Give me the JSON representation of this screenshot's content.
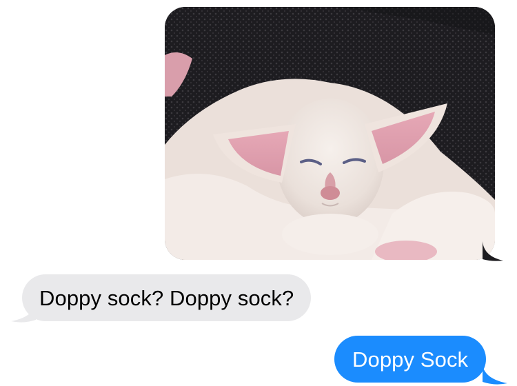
{
  "conversation": {
    "messages": [
      {
        "type": "image",
        "direction": "sent",
        "image_subject": "white-kitten-photo"
      },
      {
        "type": "text",
        "direction": "received",
        "text": "Doppy sock? Doppy sock?"
      },
      {
        "type": "text",
        "direction": "sent",
        "text": "Doppy Sock"
      }
    ]
  },
  "colors": {
    "sent_bubble": "#1b8cfe",
    "received_bubble": "#e9e9eb",
    "background": "#ffffff"
  }
}
